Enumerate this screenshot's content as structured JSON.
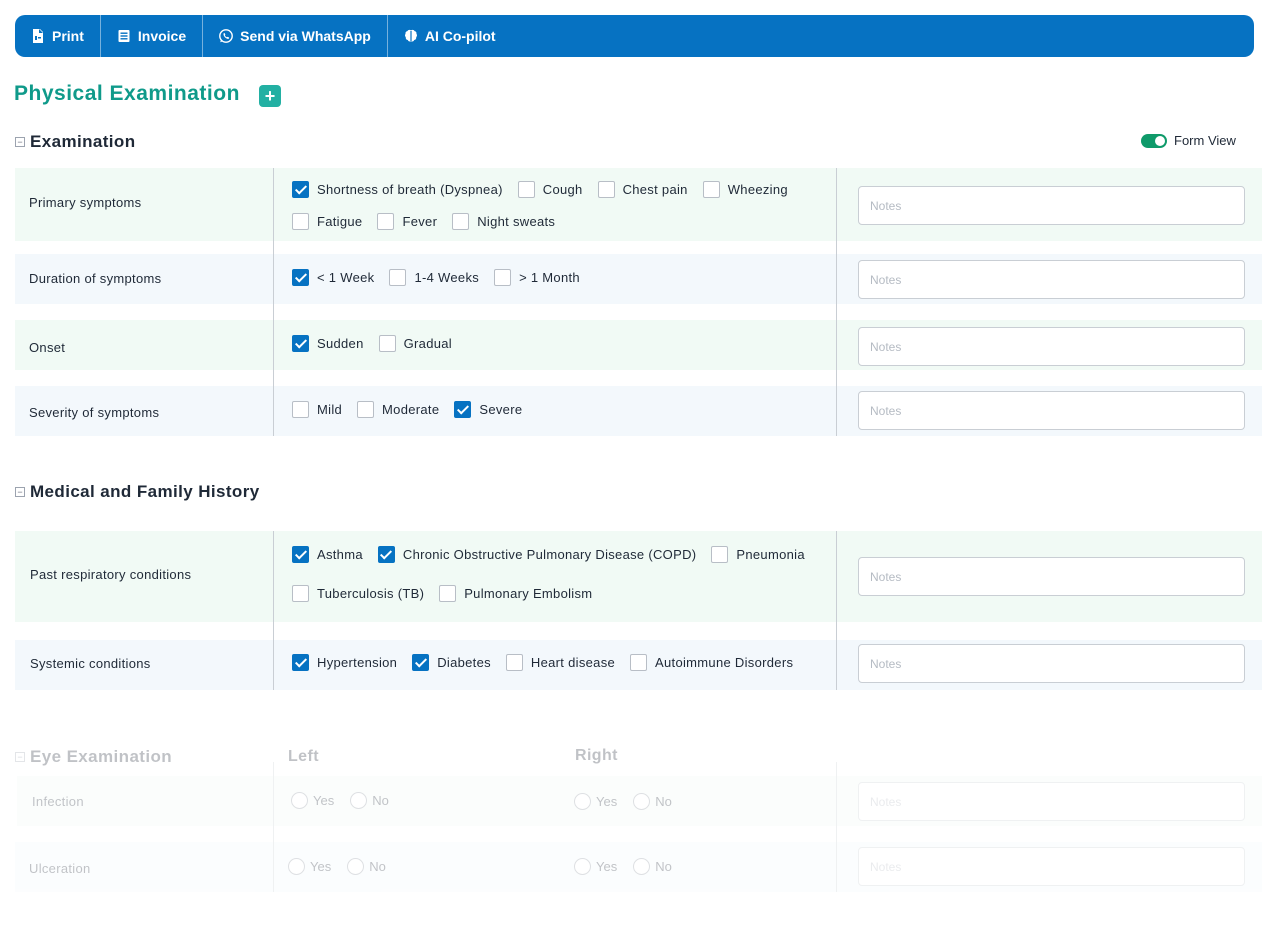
{
  "toolbar": {
    "print": "Print",
    "invoice": "Invoice",
    "whatsapp": "Send via WhatsApp",
    "copilot": "AI Co-pilot"
  },
  "page_title": "Physical Examination",
  "add_symbol": "+",
  "form_view_label": "Form View",
  "notes_placeholder": "Notes",
  "examination": {
    "title": "Examination",
    "rows": [
      {
        "label": "Primary symptoms",
        "options": [
          {
            "label": "Shortness of breath (Dyspnea)",
            "checked": true
          },
          {
            "label": "Cough",
            "checked": false
          },
          {
            "label": "Chest pain",
            "checked": false
          },
          {
            "label": "Wheezing",
            "checked": false
          },
          {
            "label": "Fatigue",
            "checked": false
          },
          {
            "label": "Fever",
            "checked": false
          },
          {
            "label": "Night sweats",
            "checked": false
          }
        ]
      },
      {
        "label": "Duration of symptoms",
        "options": [
          {
            "label": "< 1 Week",
            "checked": true
          },
          {
            "label": "1-4 Weeks",
            "checked": false
          },
          {
            "label": "> 1 Month",
            "checked": false
          }
        ]
      },
      {
        "label": "Onset",
        "options": [
          {
            "label": "Sudden",
            "checked": true
          },
          {
            "label": "Gradual",
            "checked": false
          }
        ]
      },
      {
        "label": "Severity of symptoms",
        "options": [
          {
            "label": "Mild",
            "checked": false
          },
          {
            "label": "Moderate",
            "checked": false
          },
          {
            "label": "Severe",
            "checked": true
          }
        ]
      }
    ]
  },
  "history": {
    "title": "Medical and Family History",
    "rows": [
      {
        "label": "Past respiratory conditions",
        "options": [
          {
            "label": "Asthma",
            "checked": true
          },
          {
            "label": "Chronic Obstructive Pulmonary Disease (COPD)",
            "checked": true
          },
          {
            "label": "Pneumonia",
            "checked": false
          },
          {
            "label": "Tuberculosis (TB)",
            "checked": false
          },
          {
            "label": "Pulmonary Embolism",
            "checked": false
          }
        ]
      },
      {
        "label": "Systemic conditions",
        "options": [
          {
            "label": "Hypertension",
            "checked": true
          },
          {
            "label": "Diabetes",
            "checked": true
          },
          {
            "label": "Heart disease",
            "checked": false
          },
          {
            "label": "Autoimmune Disorders",
            "checked": false
          }
        ]
      }
    ]
  },
  "eye": {
    "title": "Eye Examination",
    "left_label": "Left",
    "right_label": "Right",
    "yes": "Yes",
    "no": "No",
    "rows": [
      {
        "label": "Infection"
      },
      {
        "label": "Ulceration"
      }
    ]
  },
  "colors": {
    "toolbar": "#0672c2",
    "title_teal": "#0f9a8a",
    "checked": "#0672c2",
    "row_green": "#f1faf5",
    "row_blue": "#f3f8fc"
  },
  "icons": {
    "print": "pdf-file-icon",
    "invoice": "invoice-list-icon",
    "whatsapp": "whatsapp-icon",
    "copilot": "brain-icon"
  }
}
